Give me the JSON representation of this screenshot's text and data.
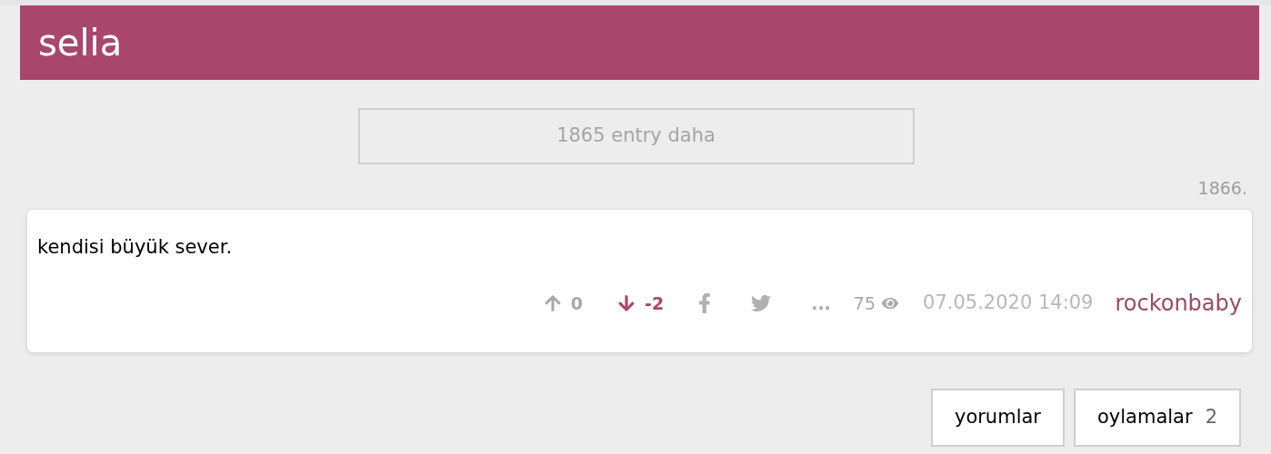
{
  "header": {
    "title": "selia"
  },
  "load_more": {
    "label": "1865 entry daha"
  },
  "entry": {
    "number": "1866.",
    "text": "kendisi büyük sever.",
    "votes": [
      {
        "kind": "up",
        "count": "0",
        "selected": false
      },
      {
        "kind": "down",
        "count": "-2",
        "selected": true
      }
    ],
    "share": [
      {
        "kind": "facebook"
      },
      {
        "kind": "twitter"
      }
    ],
    "more": "...",
    "views": "75",
    "date": "07.05.2020 14:09",
    "author": "rockonbaby"
  },
  "buttons": [
    {
      "label": "yorumlar"
    },
    {
      "label": "oylamalar",
      "count": "2"
    }
  ]
}
